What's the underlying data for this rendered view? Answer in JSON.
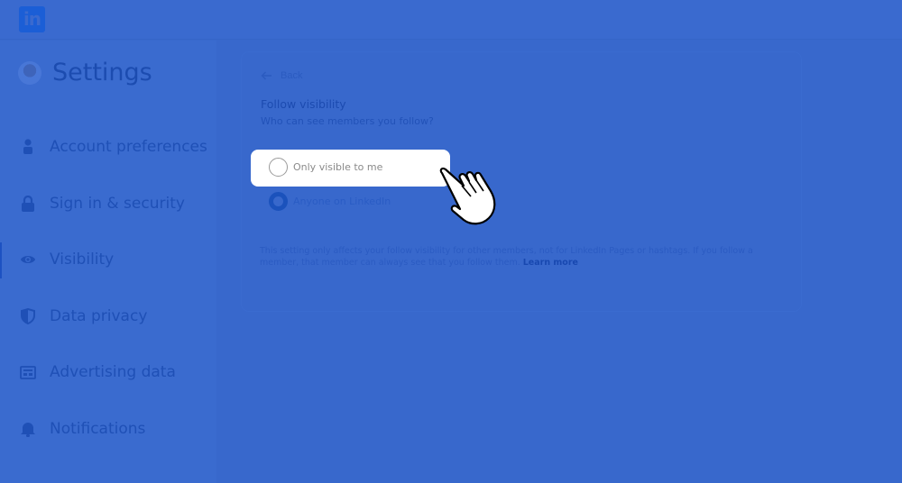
{
  "header": {
    "logo_text": "in",
    "logo_icon": "linkedin-logo-icon"
  },
  "sidebar": {
    "title": "Settings",
    "avatar": "profile-avatar",
    "items": [
      {
        "label": "Account preferences",
        "icon": "person-icon",
        "active": false
      },
      {
        "label": "Sign in & security",
        "icon": "lock-icon",
        "active": false
      },
      {
        "label": "Visibility",
        "icon": "eye-icon",
        "active": true
      },
      {
        "label": "Data privacy",
        "icon": "shield-icon",
        "active": false
      },
      {
        "label": "Advertising data",
        "icon": "ad-card-icon",
        "active": false
      },
      {
        "label": "Notifications",
        "icon": "bell-icon",
        "active": false
      }
    ]
  },
  "main": {
    "back_label": "Back",
    "title": "Follow visibility",
    "subtitle": "Who can see members you follow?",
    "options": [
      {
        "label": "Only visible to me",
        "selected": false,
        "highlighted": true
      },
      {
        "label": "Anyone on LinkedIn",
        "selected": true,
        "highlighted": false
      }
    ],
    "note_text": "This setting only affects your follow visibility for other members, not for LinkedIn Pages or hashtags. If you follow a member, that member can always see that you follow them.",
    "learn_more": "Learn more"
  },
  "overlay": {
    "cursor_icon": "pointing-hand-cursor-icon"
  },
  "colors": {
    "overlay_blue": "#3868cc",
    "linkedin_blue": "#1b5ed6",
    "highlight": "#ffffff"
  }
}
